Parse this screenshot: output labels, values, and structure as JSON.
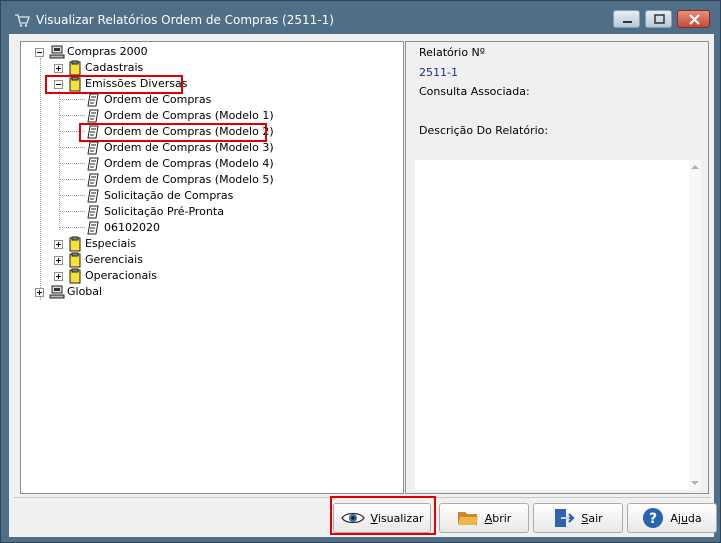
{
  "window": {
    "title": "Visualizar Relatórios Ordem de Compras (2511-1)"
  },
  "tree": {
    "root1": "Compras 2000",
    "cadastrais": "Cadastrais",
    "emissoes": "Emissões Diversas",
    "reports": [
      "Ordem de Compras",
      "Ordem de Compras (Modelo 1)",
      "Ordem de Compras (Modelo 2)",
      "Ordem de Compras (Modelo 3)",
      "Ordem de Compras (Modelo 4)",
      "Ordem de Compras (Modelo 5)",
      "Solicitação de Compras",
      "Solicitação Pré-Pronta",
      "06102020"
    ],
    "especiais": "Especiais",
    "gerenciais": "Gerenciais",
    "operacionais": "Operacionais",
    "root2": "Global"
  },
  "info": {
    "relatorio_label": "Relatório Nº",
    "relatorio_value": "2511-1",
    "consulta_label": "Consulta Associada:",
    "descricao_label": "Descrição Do Relatório:"
  },
  "buttons": {
    "visualizar_first": "V",
    "visualizar_rest": "isualizar",
    "abrir_first": "A",
    "abrir_rest": "brir",
    "sair_first": "S",
    "sair_rest": "air",
    "ajuda_pre": "Aj",
    "ajuda_acc": "u",
    "ajuda_post": "da"
  },
  "colors": {
    "titlebar": "#4f6f88",
    "highlight": "#e00000",
    "value_text": "#1a2f8c"
  }
}
